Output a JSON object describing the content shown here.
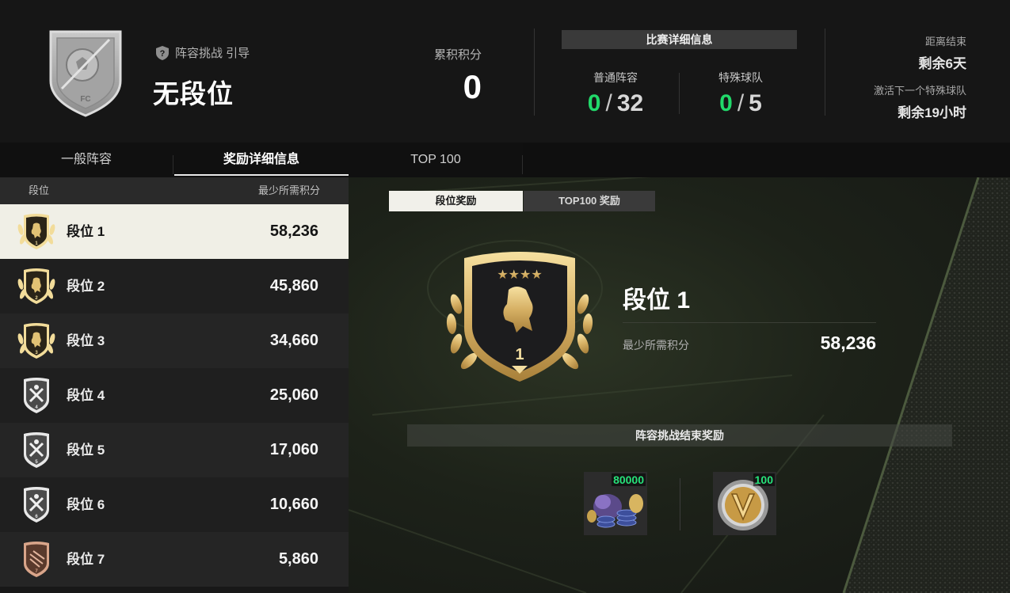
{
  "header": {
    "guide_label": "阵容挑战 引导",
    "rank_name": "无段位",
    "points_label": "累积积分",
    "points_value": "0",
    "details_title": "比赛详细信息",
    "regular": {
      "label": "普通阵容",
      "current": "0",
      "separator": "/",
      "total": "32"
    },
    "special": {
      "label": "特殊球队",
      "current": "0",
      "separator": "/",
      "total": "5"
    },
    "end_label": "距离结束",
    "end_value": "剩余6天",
    "next_label": "激活下一个特殊球队",
    "next_value": "剩余19小时"
  },
  "tabs": [
    {
      "label": "一般阵容",
      "active": false
    },
    {
      "label": "奖励详细信息",
      "active": true
    },
    {
      "label": "TOP 100",
      "active": false
    }
  ],
  "list": {
    "col_rank": "段位",
    "col_min": "最少所需积分",
    "rows": [
      {
        "name": "段位 1",
        "points": "58,236",
        "tier": "gold",
        "num": "1"
      },
      {
        "name": "段位 2",
        "points": "45,860",
        "tier": "gold",
        "num": "2"
      },
      {
        "name": "段位 3",
        "points": "34,660",
        "tier": "gold",
        "num": "3"
      },
      {
        "name": "段位 4",
        "points": "25,060",
        "tier": "silver",
        "num": "4"
      },
      {
        "name": "段位 5",
        "points": "17,060",
        "tier": "silver",
        "num": "5"
      },
      {
        "name": "段位 6",
        "points": "10,660",
        "tier": "silver",
        "num": "6"
      },
      {
        "name": "段位 7",
        "points": "5,860",
        "tier": "bronze",
        "num": "7"
      }
    ]
  },
  "detail": {
    "subtab_rank": "段位奖励",
    "subtab_top100": "TOP100 奖励",
    "rank_name": "段位 1",
    "emblem_number": "1",
    "min_label": "最少所需积分",
    "min_value": "58,236",
    "rewards_title": "阵容挑战结束奖励",
    "rewards": [
      {
        "qty": "80000",
        "icon": "coins-bundle-icon"
      },
      {
        "qty": "100",
        "icon": "v-coin-icon"
      }
    ]
  },
  "colors": {
    "accent_green": "#21d96a",
    "gold": "#d9b96a",
    "selected_row": "#f0efe6"
  }
}
